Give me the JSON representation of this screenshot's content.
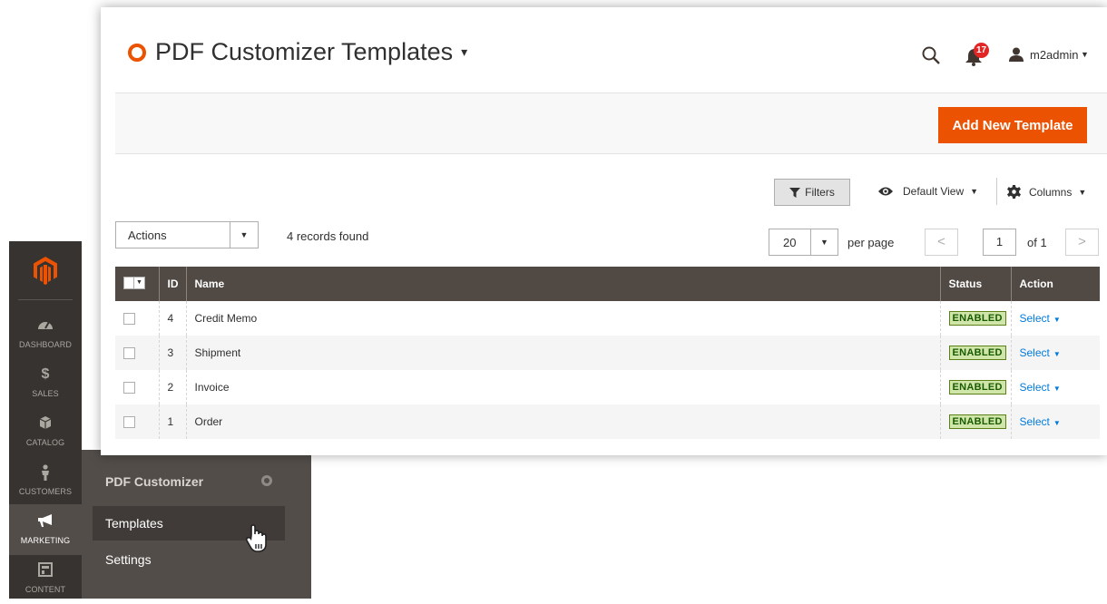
{
  "sidebar": {
    "logo": "magento-logo-icon",
    "items": [
      {
        "label": "DASHBOARD",
        "icon": "gauge-icon"
      },
      {
        "label": "SALES",
        "icon": "dollar-icon"
      },
      {
        "label": "CATALOG",
        "icon": "box-icon"
      },
      {
        "label": "CUSTOMERS",
        "icon": "person-icon"
      },
      {
        "label": "MARKETING",
        "icon": "megaphone-icon",
        "active": true
      },
      {
        "label": "CONTENT",
        "icon": "layout-icon"
      }
    ],
    "flyout": {
      "title": "PDF Customizer",
      "items": [
        "Templates",
        "Settings"
      ],
      "active": "Templates"
    }
  },
  "header": {
    "title": "PDF Customizer Templates",
    "notifications_count": "17",
    "user": "m2admin"
  },
  "toolbar": {
    "add_button": "Add New Template",
    "filters": "Filters",
    "view": "Default View",
    "columns": "Columns"
  },
  "grid": {
    "actions_label": "Actions",
    "records_found": "4 records found",
    "per_page_value": "20",
    "per_page_label": "per page",
    "current_page": "1",
    "total_pages_label": "of 1",
    "columns": [
      "ID",
      "Name",
      "Status",
      "Action"
    ],
    "rows": [
      {
        "id": "4",
        "name": "Credit Memo",
        "status": "ENABLED",
        "action": "Select"
      },
      {
        "id": "3",
        "name": "Shipment",
        "status": "ENABLED",
        "action": "Select"
      },
      {
        "id": "2",
        "name": "Invoice",
        "status": "ENABLED",
        "action": "Select"
      },
      {
        "id": "1",
        "name": "Order",
        "status": "ENABLED",
        "action": "Select"
      }
    ]
  },
  "colors": {
    "accent": "#eb5202",
    "sidebar": "#373330",
    "grid_header": "#514943",
    "link": "#007bdb",
    "enabled_badge": "#d0e5a9"
  }
}
